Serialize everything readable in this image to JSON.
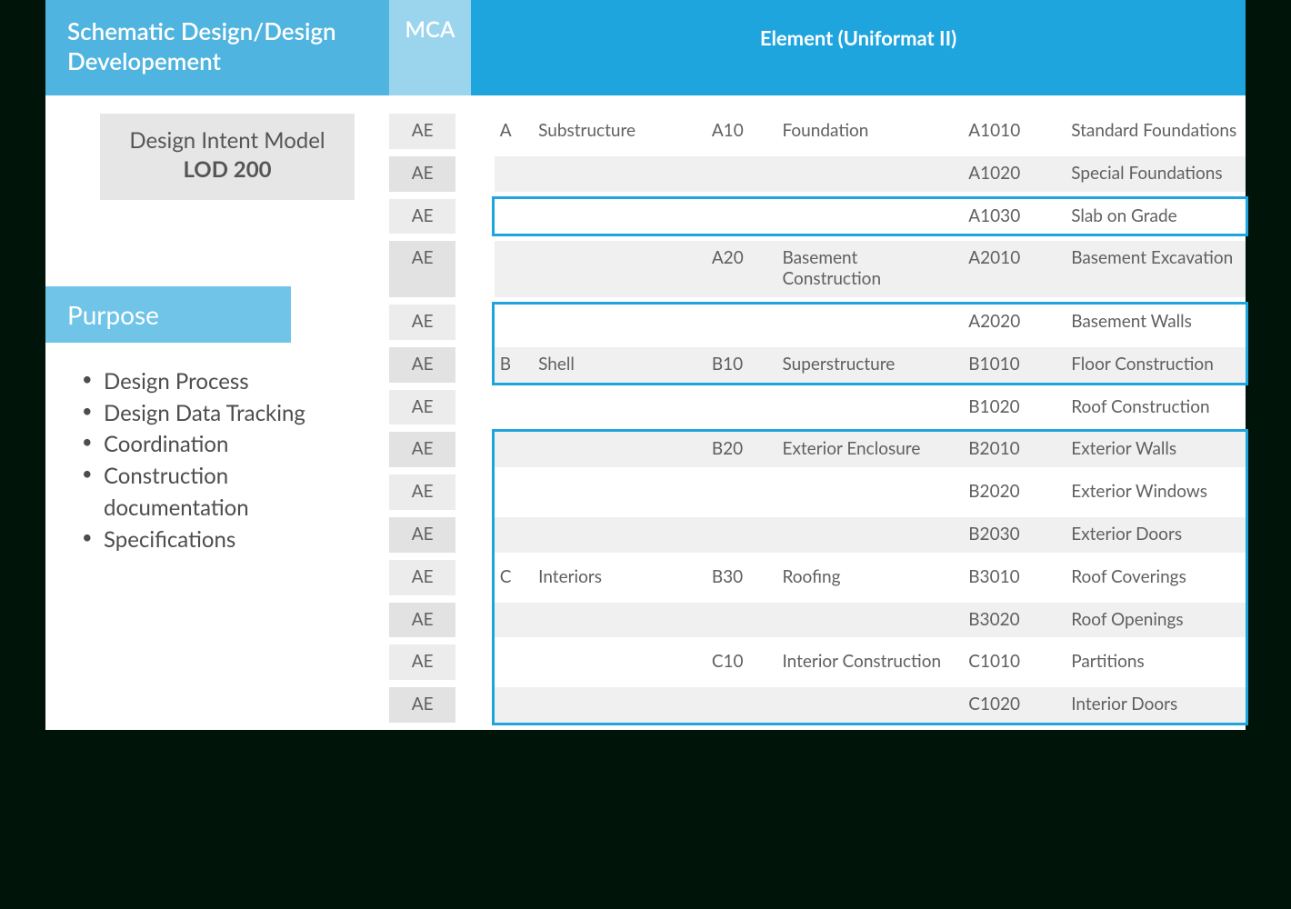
{
  "header": {
    "sdd_title": "Schematic Design/Design Developement",
    "mca_label": "MCA",
    "element_label": "Element (Uniformat II)"
  },
  "dim_box": {
    "line1": "Design Intent Model",
    "line2": "LOD 200"
  },
  "purpose": {
    "heading": "Purpose",
    "items": [
      "Design Process",
      "Design Data Tracking",
      "Coordination",
      "Construction documentation",
      "Specifications"
    ]
  },
  "table": {
    "rows": [
      {
        "mca": "AE",
        "l1c": "A",
        "l1n": "Substructure",
        "l2c": "A10",
        "l2n": "Foundation",
        "l3c": "A1010",
        "l3n": "Standard Foundations",
        "alt": false
      },
      {
        "mca": "AE",
        "l1c": "",
        "l1n": "",
        "l2c": "",
        "l2n": "",
        "l3c": "A1020",
        "l3n": "Special Foundations",
        "alt": true
      },
      {
        "mca": "AE",
        "l1c": "",
        "l1n": "",
        "l2c": "",
        "l2n": "",
        "l3c": "A1030",
        "l3n": "Slab on Grade",
        "alt": false
      },
      {
        "mca": "AE",
        "l1c": "",
        "l1n": "",
        "l2c": "A20",
        "l2n": "Basement Construction",
        "l3c": "A2010",
        "l3n": "Basement Excavation",
        "alt": true
      },
      {
        "mca": "AE",
        "l1c": "",
        "l1n": "",
        "l2c": "",
        "l2n": "",
        "l3c": "A2020",
        "l3n": "Basement Walls",
        "alt": false
      },
      {
        "mca": "AE",
        "l1c": "B",
        "l1n": "Shell",
        "l2c": "B10",
        "l2n": "Superstructure",
        "l3c": "B1010",
        "l3n": "Floor Construction",
        "alt": true
      },
      {
        "mca": "AE",
        "l1c": "",
        "l1n": "",
        "l2c": "",
        "l2n": "",
        "l3c": "B1020",
        "l3n": "Roof Construction",
        "alt": false
      },
      {
        "mca": "AE",
        "l1c": "",
        "l1n": "",
        "l2c": "B20",
        "l2n": "Exterior Enclosure",
        "l3c": "B2010",
        "l3n": "Exterior Walls",
        "alt": true
      },
      {
        "mca": "AE",
        "l1c": "",
        "l1n": "",
        "l2c": "",
        "l2n": "",
        "l3c": "B2020",
        "l3n": "Exterior Windows",
        "alt": false
      },
      {
        "mca": "AE",
        "l1c": "",
        "l1n": "",
        "l2c": "",
        "l2n": "",
        "l3c": "B2030",
        "l3n": "Exterior Doors",
        "alt": true
      },
      {
        "mca": "AE",
        "l1c": "C",
        "l1n": "Interiors",
        "l2c": "B30",
        "l2n": "Roofing",
        "l3c": "B3010",
        "l3n": "Roof Coverings",
        "alt": false
      },
      {
        "mca": "AE",
        "l1c": "",
        "l1n": "",
        "l2c": "",
        "l2n": "",
        "l3c": "B3020",
        "l3n": "Roof Openings",
        "alt": true
      },
      {
        "mca": "AE",
        "l1c": "",
        "l1n": "",
        "l2c": "C10",
        "l2n": "Interior Construction",
        "l3c": "C1010",
        "l3n": "Partitions",
        "alt": false
      },
      {
        "mca": "AE",
        "l1c": "",
        "l1n": "",
        "l2c": "",
        "l2n": "",
        "l3c": "C1020",
        "l3n": "Interior Doors",
        "alt": true
      }
    ]
  },
  "highlights": {
    "boxes": [
      {
        "row_start": 2,
        "row_end": 2
      },
      {
        "row_start": 4,
        "row_end": 5
      },
      {
        "row_start": 7,
        "row_end": 13
      }
    ]
  }
}
